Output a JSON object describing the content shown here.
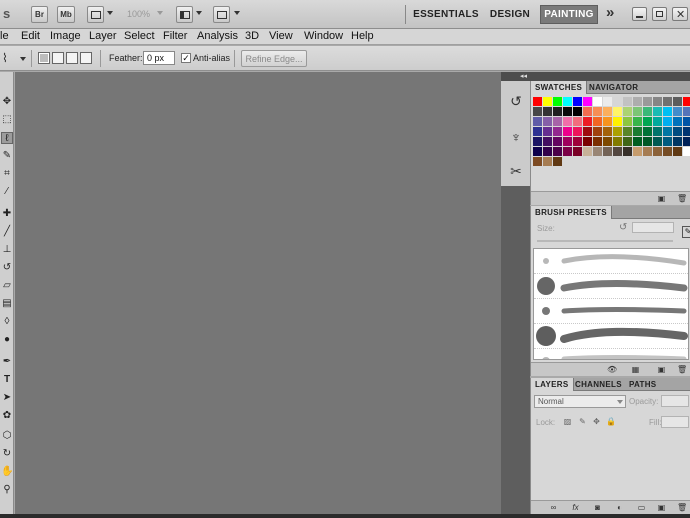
{
  "appbar": {
    "logo": "s",
    "bridge": "Br",
    "minibridge": "Mb",
    "zoom": "100%",
    "workspaces": [
      "ESSENTIALS",
      "DESIGN",
      "PAINTING"
    ],
    "active_workspace": "PAINTING",
    "more": "»"
  },
  "menu": [
    "le",
    "Edit",
    "Image",
    "Layer",
    "Select",
    "Filter",
    "Analysis",
    "3D",
    "View",
    "Window",
    "Help"
  ],
  "options": {
    "feather_label": "Feather:",
    "feather_value": "0 px",
    "antialias_label": "Anti-alias",
    "antialias_checked": "✓",
    "refine_edge": "Refine Edge..."
  },
  "swatches_panel": {
    "tabs": [
      "SWATCHES",
      "NAVIGATOR"
    ],
    "colors": [
      "#ff0000",
      "#ffff00",
      "#00ff00",
      "#00ffff",
      "#0000ff",
      "#ff00ff",
      "#ffffff",
      "#ebebeb",
      "#d6d6d6",
      "#c2c2c2",
      "#adadad",
      "#999999",
      "#858585",
      "#707070",
      "#5c5c5c",
      "#ff0000",
      "#474747",
      "#333333",
      "#1f1f1f",
      "#0a0a0a",
      "#000000",
      "#f26c4f",
      "#f68e55",
      "#fbaf5c",
      "#fff467",
      "#acd372",
      "#7cc576",
      "#3bb878",
      "#1abbb4",
      "#00bff3",
      "#438ccb",
      "#5574b9",
      "#605ca8",
      "#855fa8",
      "#a763a8",
      "#f06ea9",
      "#f26d7d",
      "#ed1c24",
      "#f26522",
      "#f7941d",
      "#fff200",
      "#8dc63f",
      "#39b54a",
      "#00a651",
      "#00a99d",
      "#00aeef",
      "#0072bc",
      "#0054a6",
      "#2e3192",
      "#662d91",
      "#92278f",
      "#ec008c",
      "#ed145b",
      "#9e0b0f",
      "#a0410d",
      "#a36209",
      "#aba000",
      "#598527",
      "#1a7b30",
      "#007236",
      "#00746b",
      "#0076a3",
      "#004b80",
      "#003471",
      "#1b1464",
      "#440e62",
      "#630460",
      "#9e005d",
      "#9e0039",
      "#790000",
      "#7b2e00",
      "#7d4900",
      "#827b00",
      "#406618",
      "#005e20",
      "#005826",
      "#005952",
      "#005b7f",
      "#003663",
      "#002157",
      "#0d004c",
      "#32004b",
      "#4b0049",
      "#7b0046",
      "#7a0026",
      "#c7b299",
      "#998675",
      "#736357",
      "#534741",
      "#37302a",
      "#c69c6d",
      "#a67c52",
      "#8c6239",
      "#754c24",
      "#603913",
      "#ffffff",
      "#7d4b23",
      "#a67c52",
      "#603913"
    ]
  },
  "brush_panel": {
    "tabs": [
      "BRUSH PRESETS"
    ],
    "size_label": "Size:"
  },
  "layers_panel": {
    "tabs": [
      "LAYERS",
      "CHANNELS",
      "PATHS"
    ],
    "blend_mode": "Normal",
    "opacity_label": "Opacity:",
    "lock_label": "Lock:",
    "fill_label": "Fill:"
  },
  "icons": {
    "tools": [
      "move-icon",
      "marquee-icon",
      "lasso-icon",
      "quick-select-icon",
      "crop-icon",
      "eyedropper-icon",
      "healing-icon",
      "brush-icon",
      "clone-stamp-icon",
      "history-brush-icon",
      "eraser-icon",
      "gradient-icon",
      "blur-icon",
      "dodge-icon",
      "pen-icon",
      "type-icon",
      "path-select-icon",
      "shape-icon",
      "3d-rotate-icon",
      "3d-orbit-icon",
      "hand-icon",
      "zoom-icon"
    ]
  }
}
